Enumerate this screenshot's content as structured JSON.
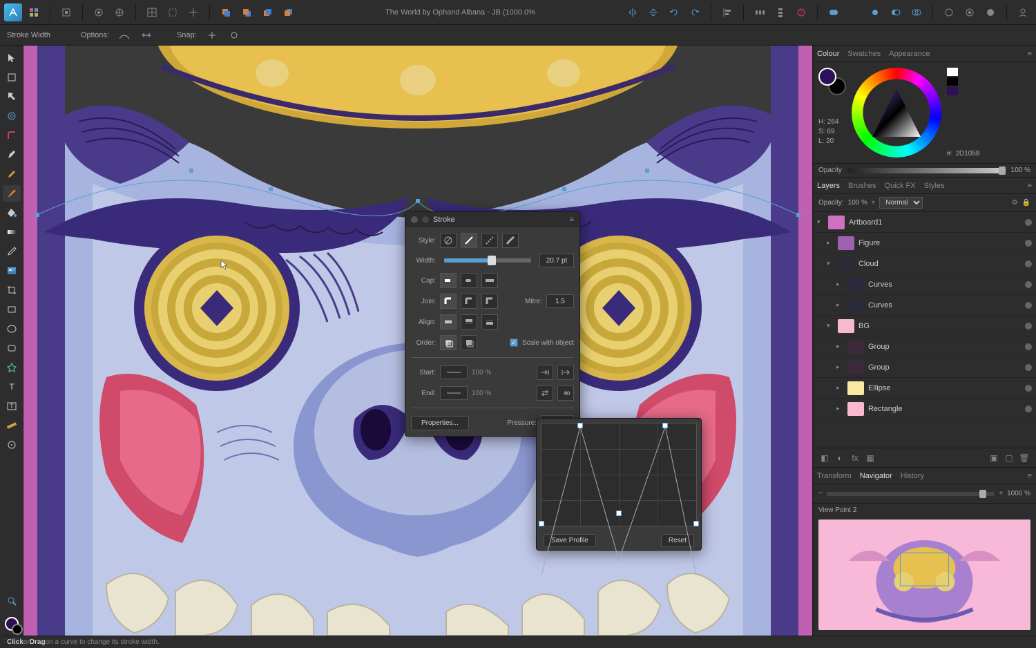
{
  "top_toolbar": {
    "doc_title": "The World by Ophand Albana - JB (1000.0%"
  },
  "options_bar": {
    "stroke_width_label": "Stroke Width",
    "options_label": "Options:",
    "snap_label": "Snap:"
  },
  "colour_panel": {
    "tabs": {
      "colour": "Colour",
      "swatches": "Swatches",
      "appearance": "Appearance"
    },
    "hsl": {
      "h_label": "H:",
      "h": "264",
      "s_label": "S:",
      "s": "69",
      "l_label": "L:",
      "l": "20"
    },
    "hex_prefix": "#:",
    "hex": "2D1058",
    "opacity_label": "Opacity",
    "opacity_value": "100 %"
  },
  "layers_panel": {
    "tabs": {
      "layers": "Layers",
      "brushes": "Brushes",
      "quick_fx": "Quick FX",
      "styles": "Styles"
    },
    "opacity_label": "Opacity:",
    "opacity_value": "100 %",
    "blend_mode": "Normal",
    "items": [
      {
        "name": "Artboard1",
        "thumb": "#d070c0",
        "indent": 0,
        "expanded": true
      },
      {
        "name": "Figure",
        "thumb": "#a060b0",
        "indent": 1,
        "expanded": false
      },
      {
        "name": "Cloud",
        "thumb": "#2a2a3a",
        "indent": 1,
        "expanded": true
      },
      {
        "name": "Curves",
        "thumb": "#2a2a3a",
        "indent": 2,
        "expanded": false
      },
      {
        "name": "Curves",
        "thumb": "#2a2a3a",
        "indent": 2,
        "expanded": false
      },
      {
        "name": "BG",
        "thumb": "#f8b8d0",
        "indent": 1,
        "expanded": true
      },
      {
        "name": "Group",
        "thumb": "#3a2a3a",
        "indent": 2,
        "expanded": false
      },
      {
        "name": "Group",
        "thumb": "#3a2a3a",
        "indent": 2,
        "expanded": false
      },
      {
        "name": "Ellipse",
        "thumb": "#f8e8a0",
        "indent": 2,
        "expanded": false
      },
      {
        "name": "Rectangle",
        "thumb": "#f8b8d0",
        "indent": 2,
        "expanded": false
      }
    ]
  },
  "navigator_panel": {
    "tabs": {
      "transform": "Transform",
      "navigator": "Navigator",
      "history": "History"
    },
    "zoom_value": "1000 %",
    "viewpoint": "View Point 2"
  },
  "stroke_panel": {
    "title": "Stroke",
    "style_label": "Style:",
    "width_label": "Width:",
    "width_value": "20.7 pt",
    "cap_label": "Cap:",
    "join_label": "Join:",
    "mitre_label": "Mitre:",
    "mitre_value": "1.5",
    "align_label": "Align:",
    "order_label": "Order:",
    "scale_label": "Scale with object",
    "start_label": "Start:",
    "start_pct": "100 %",
    "end_label": "End:",
    "end_pct": "100 %",
    "properties_btn": "Properties...",
    "pressure_label": "Pressure:"
  },
  "pressure_popout": {
    "save_btn": "Save Profile",
    "reset_btn": "Reset"
  },
  "footer": {
    "click": "Click",
    "or": " or ",
    "drag": "Drag",
    "rest": " on a curve to change its stroke width."
  }
}
